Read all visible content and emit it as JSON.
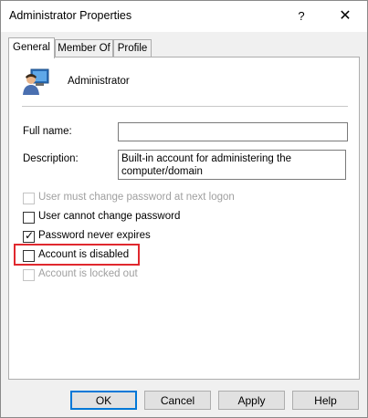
{
  "window": {
    "title": "Administrator Properties",
    "help_glyph": "?",
    "close_glyph": "✕"
  },
  "tabs": [
    {
      "label": "General",
      "active": true
    },
    {
      "label": "Member Of",
      "active": false
    },
    {
      "label": "Profile",
      "active": false
    }
  ],
  "general": {
    "user_icon": "user-icon",
    "user_name": "Administrator",
    "full_name_label": "Full name:",
    "full_name_value": "",
    "description_label": "Description:",
    "description_value": "Built-in account for administering the computer/domain"
  },
  "options": [
    {
      "label": "User must change password at next logon",
      "checked": false,
      "enabled": false
    },
    {
      "label": "User cannot change password",
      "checked": false,
      "enabled": true
    },
    {
      "label": "Password never expires",
      "checked": true,
      "enabled": true
    },
    {
      "label": "Account is disabled",
      "checked": false,
      "enabled": true,
      "highlighted": true
    },
    {
      "label": "Account is locked out",
      "checked": false,
      "enabled": false
    }
  ],
  "buttons": {
    "ok": "OK",
    "cancel": "Cancel",
    "apply": "Apply",
    "help": "Help"
  },
  "colors": {
    "highlight_border": "#e0282e",
    "default_button_border": "#0078d7"
  }
}
